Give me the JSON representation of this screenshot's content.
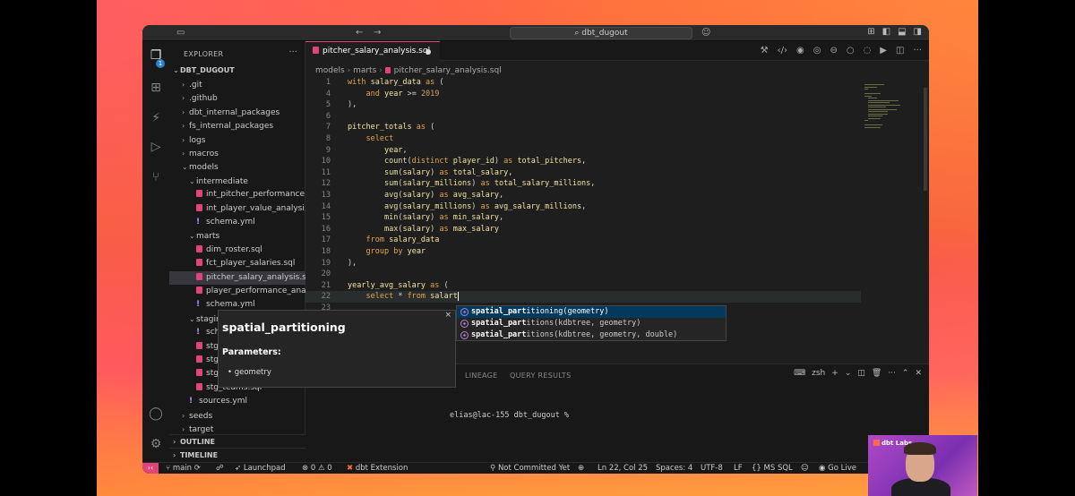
{
  "titlebar": {
    "search_text": "dbt_dugout"
  },
  "explorer": {
    "title": "EXPLORER",
    "root": "DBT_DUGOUT",
    "items": [
      {
        "label": ".git",
        "type": "folder"
      },
      {
        "label": ".github",
        "type": "folder"
      },
      {
        "label": "dbt_internal_packages",
        "type": "folder"
      },
      {
        "label": "fs_internal_packages",
        "type": "folder"
      },
      {
        "label": "logs",
        "type": "folder"
      },
      {
        "label": "macros",
        "type": "folder"
      },
      {
        "label": "models",
        "type": "folder-open"
      },
      {
        "label": "intermediate",
        "type": "folder-open"
      },
      {
        "label": "int_pitcher_performance...",
        "type": "sql"
      },
      {
        "label": "int_player_value_analysi...",
        "type": "sql"
      },
      {
        "label": "schema.yml",
        "type": "yml"
      },
      {
        "label": "marts",
        "type": "folder-open"
      },
      {
        "label": "dim_roster.sql",
        "type": "sql"
      },
      {
        "label": "fct_player_salaries.sql",
        "type": "sql"
      },
      {
        "label": "pitcher_salary_analysis.sql",
        "type": "sql"
      },
      {
        "label": "player_performance_ana...",
        "type": "sql"
      },
      {
        "label": "schema.yml",
        "type": "yml"
      },
      {
        "label": "staging",
        "type": "folder-open"
      },
      {
        "label": "sche",
        "type": "yml"
      },
      {
        "label": "stg_",
        "type": "sql"
      },
      {
        "label": "stg_",
        "type": "sql"
      },
      {
        "label": "stg_",
        "type": "sql"
      },
      {
        "label": "stg_teams.sql",
        "type": "sql"
      },
      {
        "label": "sources.yml",
        "type": "yml"
      },
      {
        "label": "seeds",
        "type": "folder"
      },
      {
        "label": "target",
        "type": "folder"
      }
    ],
    "outline_label": "OUTLINE",
    "timeline_label": "TIMELINE"
  },
  "tab": {
    "label": "pitcher_salary_analysis.sql"
  },
  "breadcrumb": {
    "p1": "models",
    "p2": "marts",
    "p3": "pitcher_salary_analysis.sql"
  },
  "code_lines": [
    {
      "n": "1",
      "text": "with salary_data as ("
    },
    {
      "n": "4",
      "text": "    and year >= 2019"
    },
    {
      "n": "5",
      "text": "),"
    },
    {
      "n": "6",
      "text": ""
    },
    {
      "n": "7",
      "text": "pitcher_totals as ("
    },
    {
      "n": "8",
      "text": "    select"
    },
    {
      "n": "9",
      "text": "        year,"
    },
    {
      "n": "10",
      "text": "        count(distinct player_id) as total_pitchers,"
    },
    {
      "n": "11",
      "text": "        sum(salary) as total_salary,"
    },
    {
      "n": "12",
      "text": "        sum(salary_millions) as total_salary_millions,"
    },
    {
      "n": "13",
      "text": "        avg(salary) as avg_salary,"
    },
    {
      "n": "14",
      "text": "        avg(salary_millions) as avg_salary_millions,"
    },
    {
      "n": "15",
      "text": "        min(salary) as min_salary,"
    },
    {
      "n": "16",
      "text": "        max(salary) as max_salary"
    },
    {
      "n": "17",
      "text": "    from salary_data"
    },
    {
      "n": "18",
      "text": "    group by year"
    },
    {
      "n": "19",
      "text": "),"
    },
    {
      "n": "20",
      "text": ""
    },
    {
      "n": "21",
      "text": "yearly_avg_salary as ("
    },
    {
      "n": "22",
      "text": "    select * from salart"
    },
    {
      "n": "23",
      "text": ""
    }
  ],
  "suggestions": [
    {
      "match": "spatial_part",
      "rest": "itioning(geometry)"
    },
    {
      "match": "spatial_part",
      "rest": "itions(kdbtree, geometry)"
    },
    {
      "match": "spatial_part",
      "rest": "itions(kdbtree, geometry, double)"
    }
  ],
  "doc": {
    "title": "spatial_partitioning",
    "params_label": "Parameters:",
    "param": "geometry",
    "close": "×"
  },
  "panel": {
    "tab_lineage": "LINEAGE",
    "tab_query": "QUERY RESULTS",
    "shell": "zsh",
    "terminal_prompt": "elias@lac-155 dbt_dugout %"
  },
  "status": {
    "branch": "main",
    "launchpad": "Launchpad",
    "errors": "0",
    "warnings": "0",
    "dbt": "dbt Extension",
    "git_state": "Not Committed Yet",
    "position": "Ln 22, Col 25",
    "spaces": "Spaces: 4",
    "encoding": "UTF-8",
    "eol": "LF",
    "language": "MS SQL",
    "golive": "Go Live"
  },
  "webcam": {
    "logo": "dbt Labs"
  }
}
